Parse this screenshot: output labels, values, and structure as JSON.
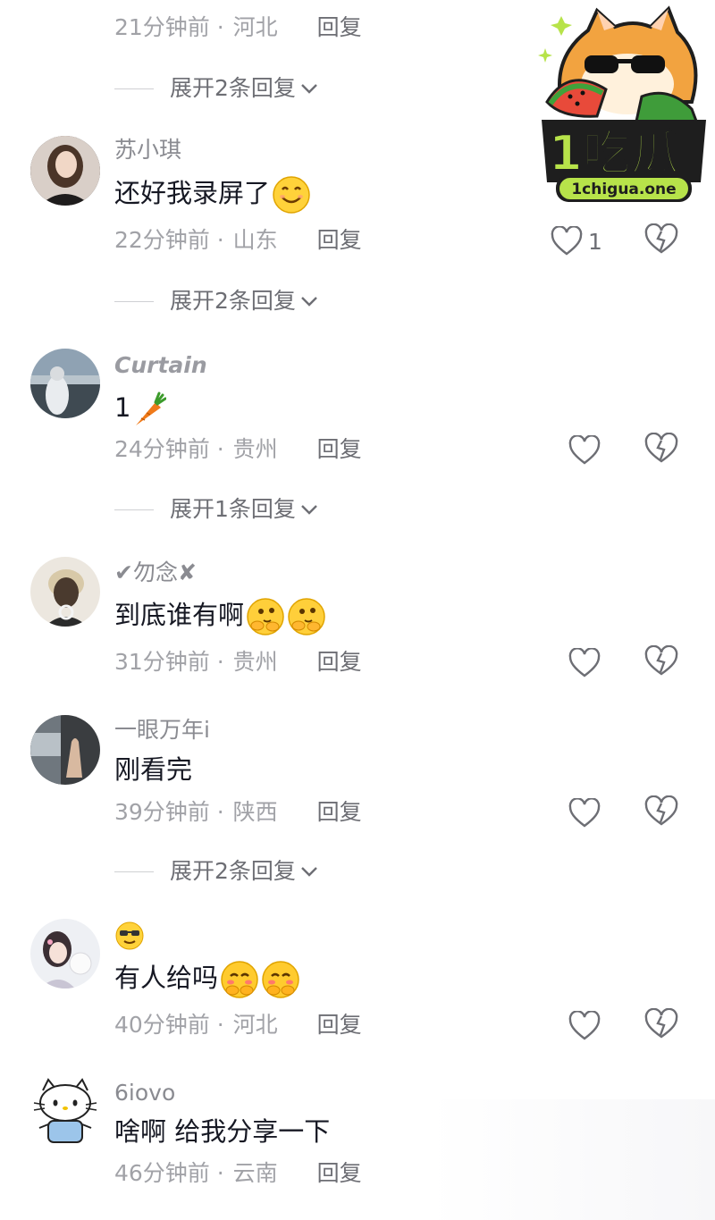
{
  "top_partial": {
    "meta": {
      "time": "21分钟前",
      "sep": "·",
      "location": "河北",
      "reply": "回复"
    },
    "expand": "展开2条回复"
  },
  "watermark": {
    "brand": "1吃瓜",
    "url": "1chigua.one"
  },
  "comments": [
    {
      "username": "苏小琪",
      "text": "还好我录屏了",
      "emojis": [
        "smile-emoji"
      ],
      "time": "22分钟前",
      "sep": "·",
      "location": "山东",
      "reply": "回复",
      "likes": "1",
      "expand": "展开2条回复"
    },
    {
      "username": "Curtain",
      "text": "1",
      "emojis": [
        "carrot-emoji"
      ],
      "time": "24分钟前",
      "sep": "·",
      "location": "贵州",
      "reply": "回复",
      "likes": "",
      "expand": "展开1条回复"
    },
    {
      "username": "✔勿念✘",
      "text": "到底谁有啊",
      "emojis": [
        "shy-emoji",
        "shy-emoji"
      ],
      "time": "31分钟前",
      "sep": "·",
      "location": "贵州",
      "reply": "回复",
      "likes": ""
    },
    {
      "username": "一眼万年i",
      "text": "刚看完",
      "emojis": [],
      "time": "39分钟前",
      "sep": "·",
      "location": "陕西",
      "reply": "回复",
      "likes": "",
      "expand": "展开2条回复"
    },
    {
      "username": "😎",
      "text": "有人给吗",
      "emojis": [
        "pleading-emoji",
        "pleading-emoji"
      ],
      "time": "40分钟前",
      "sep": "·",
      "location": "河北",
      "reply": "回复",
      "likes": ""
    },
    {
      "username": "6iovo",
      "text": "啥啊 给我分享一下",
      "emojis": [],
      "time": "46分钟前",
      "sep": "·",
      "location": "云南",
      "reply": "回复"
    }
  ],
  "colors": {
    "text": "#161823",
    "meta": "#a1a2a7",
    "reply": "#6d6e74",
    "name": "#8a8b91"
  }
}
